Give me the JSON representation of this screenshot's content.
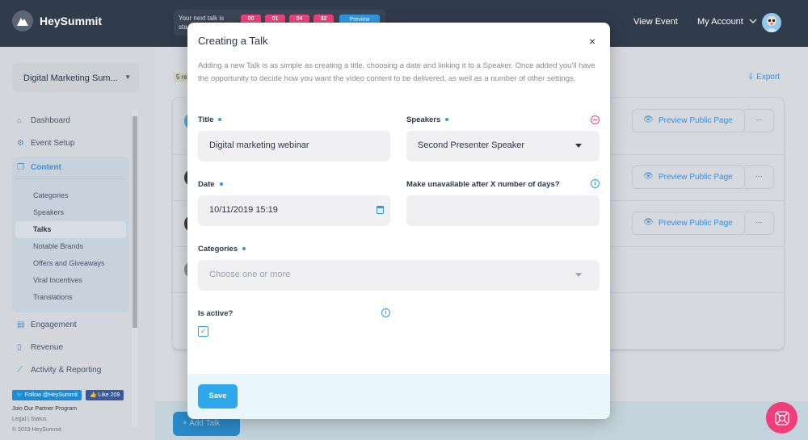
{
  "topbar": {
    "brand": "HeySummit",
    "countdown_text": "Your next talk is sta",
    "countdown": [
      "00",
      "01",
      "04",
      "32"
    ],
    "countdown_button": "Preview",
    "view_event": "View Event",
    "my_account": "My Account"
  },
  "sidebar": {
    "event_name": "Digital Marketing Sum...",
    "items": [
      {
        "label": "Dashboard",
        "icon": "home-icon"
      },
      {
        "label": "Event Setup",
        "icon": "gears-icon"
      }
    ],
    "content": {
      "label": "Content",
      "icon": "copy-icon",
      "sub_items": [
        "Categories",
        "Speakers",
        "Talks",
        "Notable Brands",
        "Offers and Giveaways",
        "Viral Incentives",
        "Translations"
      ],
      "active": "Talks"
    },
    "items_after": [
      {
        "label": "Engagement",
        "icon": "chat-icon"
      },
      {
        "label": "Revenue",
        "icon": "revenue-icon"
      },
      {
        "label": "Activity & Reporting",
        "icon": "chart-icon"
      }
    ],
    "twitter_follow": "Follow @HeySummit",
    "fb_like": "Like 209",
    "partner": "Join Our Partner Program",
    "legal": "Legal",
    "status": "Status",
    "copyright": "© 2019 HeySummit"
  },
  "main": {
    "results": "5 re",
    "export": "Export",
    "preview_label": "Preview Public Page",
    "more_label": "···",
    "add_talk": "+ Add Talk"
  },
  "modal": {
    "title": "Creating a Talk",
    "close": "×",
    "description": "Adding a new Talk is as simple as creating a title, choosing a date and linking it to a Speaker. Once added you'll have the opportunity to decide how you want the video content to be delivered, as well as a number of other settings.",
    "title_label": "Title",
    "title_value": "Digital marketing webinar",
    "speakers_label": "Speakers",
    "speakers_value": "Second Presenter Speaker",
    "date_label": "Date",
    "date_value": "10/11/2019 15:19",
    "unavailable_label": "Make unavailable after X number of days?",
    "unavailable_value": "",
    "categories_label": "Categories",
    "categories_placeholder": "Choose one or more",
    "is_active_label": "Is active?",
    "is_active": true,
    "save": "Save"
  },
  "colors": {
    "accent": "#2f9ae0",
    "topbar": "#303b4c",
    "countdown": "#e8467c",
    "help": "#f03e7b"
  }
}
